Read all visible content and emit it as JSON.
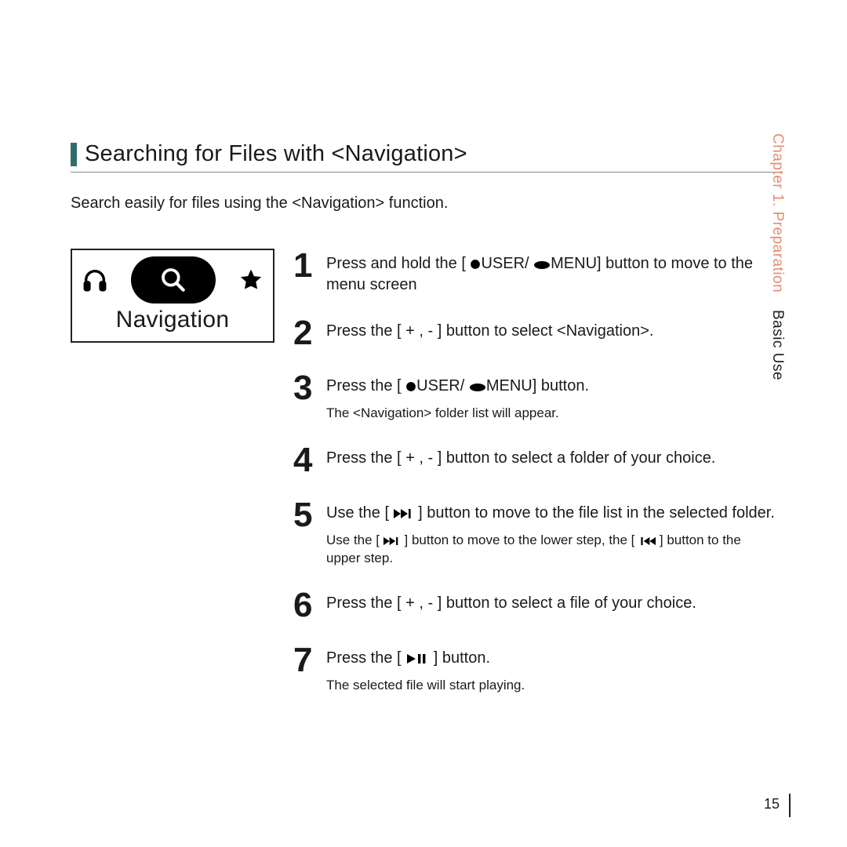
{
  "side": {
    "chapter": "Chapter 1. Preparation",
    "section": "Basic Use"
  },
  "page_number": "15",
  "title": "Searching for Files with <Navigation>",
  "intro": "Search easily for files using the <Navigation> function.",
  "illustration": {
    "label": "Navigation"
  },
  "steps": [
    {
      "num": "1",
      "text_before": "Press and hold the [",
      "mid1": "USER/",
      "text_after": "MENU] button to move to the menu screen",
      "note": ""
    },
    {
      "num": "2",
      "text": "Press the [ + , - ] button to select <Navigation>.",
      "note": ""
    },
    {
      "num": "3",
      "text_before": "Press the  [",
      "mid1": "USER/",
      "text_after": "MENU] button.",
      "note": "The <Navigation> folder list will appear."
    },
    {
      "num": "4",
      "text": "Press the [ + , - ] button to select a folder of your choice.",
      "note": ""
    },
    {
      "num": "5",
      "text_before": "Use the [",
      "text_after": "] button to move to the file list in the selected folder.",
      "note_before": "Use the [",
      "note_mid": "] button to move to the lower step, the [",
      "note_after": "] button to the upper step."
    },
    {
      "num": "6",
      "text": "Press the [ + , - ] button to select a file of your choice.",
      "note": ""
    },
    {
      "num": "7",
      "text_before": "Press the  [",
      "text_after": "] button.",
      "note": "The selected file will start playing."
    }
  ]
}
